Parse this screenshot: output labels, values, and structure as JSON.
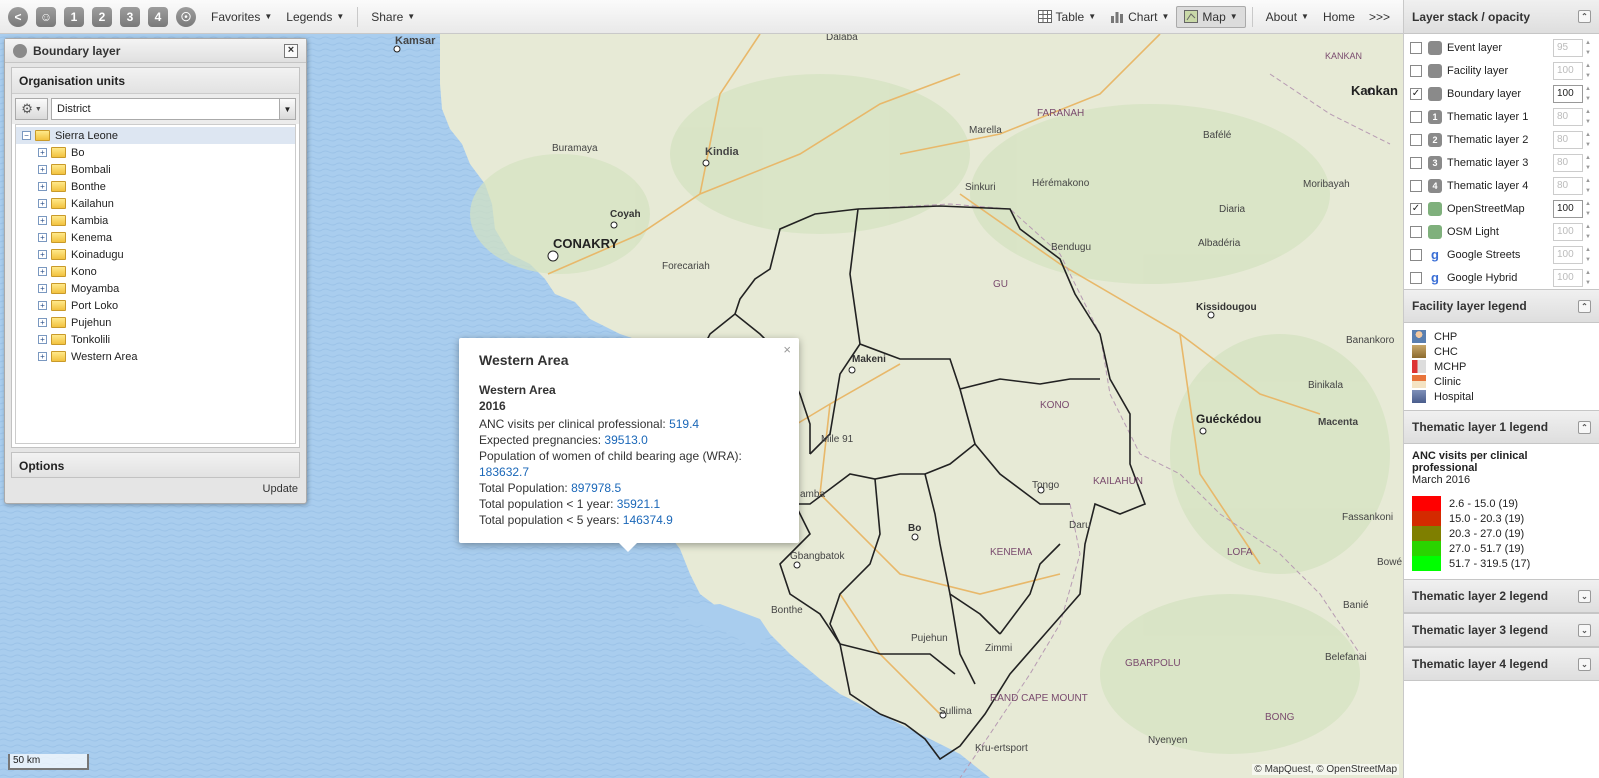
{
  "toolbar": {
    "layer_buttons": [
      "1",
      "2",
      "3",
      "4"
    ],
    "favorites": "Favorites",
    "legends": "Legends",
    "share": "Share",
    "table": "Table",
    "chart": "Chart",
    "map": "Map",
    "about": "About",
    "home": "Home",
    "more": ">>>"
  },
  "layer_stack": {
    "title": "Layer stack / opacity",
    "layers": [
      {
        "name": "Event layer",
        "checked": false,
        "opacity": "95",
        "icon": "event-icon"
      },
      {
        "name": "Facility layer",
        "checked": false,
        "opacity": "100",
        "icon": "facility-icon"
      },
      {
        "name": "Boundary layer",
        "checked": true,
        "opacity": "100",
        "icon": "boundary-icon"
      },
      {
        "name": "Thematic layer 1",
        "checked": false,
        "opacity": "80",
        "icon": "1"
      },
      {
        "name": "Thematic layer 2",
        "checked": false,
        "opacity": "80",
        "icon": "2"
      },
      {
        "name": "Thematic layer 3",
        "checked": false,
        "opacity": "80",
        "icon": "3"
      },
      {
        "name": "Thematic layer 4",
        "checked": false,
        "opacity": "80",
        "icon": "4"
      },
      {
        "name": "OpenStreetMap",
        "checked": true,
        "opacity": "100",
        "icon": "osm-icon"
      },
      {
        "name": "OSM Light",
        "checked": false,
        "opacity": "100",
        "icon": "osm-icon"
      },
      {
        "name": "Google Streets",
        "checked": false,
        "opacity": "100",
        "icon": "google-icon"
      },
      {
        "name": "Google Hybrid",
        "checked": false,
        "opacity": "100",
        "icon": "google-icon"
      }
    ]
  },
  "facility_legend": {
    "title": "Facility layer legend",
    "items": [
      "CHP",
      "CHC",
      "MCHP",
      "Clinic",
      "Hospital"
    ]
  },
  "thematic_legend_1": {
    "title": "Thematic layer 1 legend",
    "indicator": "ANC visits per clinical professional",
    "period": "March 2016",
    "classes": [
      {
        "label": "2.6 - 15.0 (19)",
        "color": "#ff0000"
      },
      {
        "label": "15.0 - 20.3 (19)",
        "color": "#d42a00"
      },
      {
        "label": "20.3 - 27.0 (19)",
        "color": "#7f7f00"
      },
      {
        "label": "27.0 - 51.7 (19)",
        "color": "#2ad400"
      },
      {
        "label": "51.7 - 319.5 (17)",
        "color": "#00ff00"
      }
    ]
  },
  "collapsed_legends": [
    "Thematic layer 2 legend",
    "Thematic layer 3 legend",
    "Thematic layer 4 legend"
  ],
  "boundary_panel": {
    "title": "Boundary layer",
    "org_units_title": "Organisation units",
    "level_value": "District",
    "root": "Sierra Leone",
    "children": [
      "Bo",
      "Bombali",
      "Bonthe",
      "Kailahun",
      "Kambia",
      "Kenema",
      "Koinadugu",
      "Kono",
      "Moyamba",
      "Port Loko",
      "Pujehun",
      "Tonkolili",
      "Western Area"
    ],
    "options": "Options",
    "update": "Update"
  },
  "popup": {
    "title": "Western Area",
    "subtitle": "Western Area",
    "year": "2016",
    "rows": [
      {
        "label": "ANC visits per clinical professional: ",
        "value": "519.4"
      },
      {
        "label": "Expected pregnancies: ",
        "value": "39513.0"
      },
      {
        "label": "Population of women of child bearing age (WRA): ",
        "value": "183632.7"
      },
      {
        "label": "Total Population: ",
        "value": "897978.5"
      },
      {
        "label": "Total population < 1 year: ",
        "value": "35921.1"
      },
      {
        "label": "Total population < 5 years: ",
        "value": "146374.9"
      }
    ]
  },
  "map": {
    "places": [
      "Kamsar",
      "Dalaba",
      "KANKAN",
      "Kankan",
      "FARANAH",
      "Marella",
      "Bafélé",
      "Buramaya",
      "Kindia",
      "Sinkuri",
      "Hérémakono",
      "Coyah",
      "CONAKRY",
      "Forecariah",
      "Diaria",
      "Bendugu",
      "Albadéria",
      "Moribayah",
      "GU",
      "Kissidougou",
      "Banankoro",
      "Makeni",
      "KONO",
      "Binikala",
      "Guéckédou",
      "Macenta",
      "Mile 91",
      "Tongo",
      "KAILAHUN",
      "Bo",
      "Daru",
      "Fassankoni",
      "Gbangbatok",
      "KENEMA",
      "LOFA",
      "Bonthe",
      "Pujehun",
      "Zimmi",
      "Banié",
      "GBARPOLU",
      "Belefanai",
      "Sullima",
      "RAND CAPE MOUNT",
      "BONG",
      "Kru-ertsport",
      "Nyenyen",
      "Bowé",
      "amba"
    ],
    "scale": "50 km",
    "attribution": "© MapQuest, © OpenStreetMap"
  }
}
